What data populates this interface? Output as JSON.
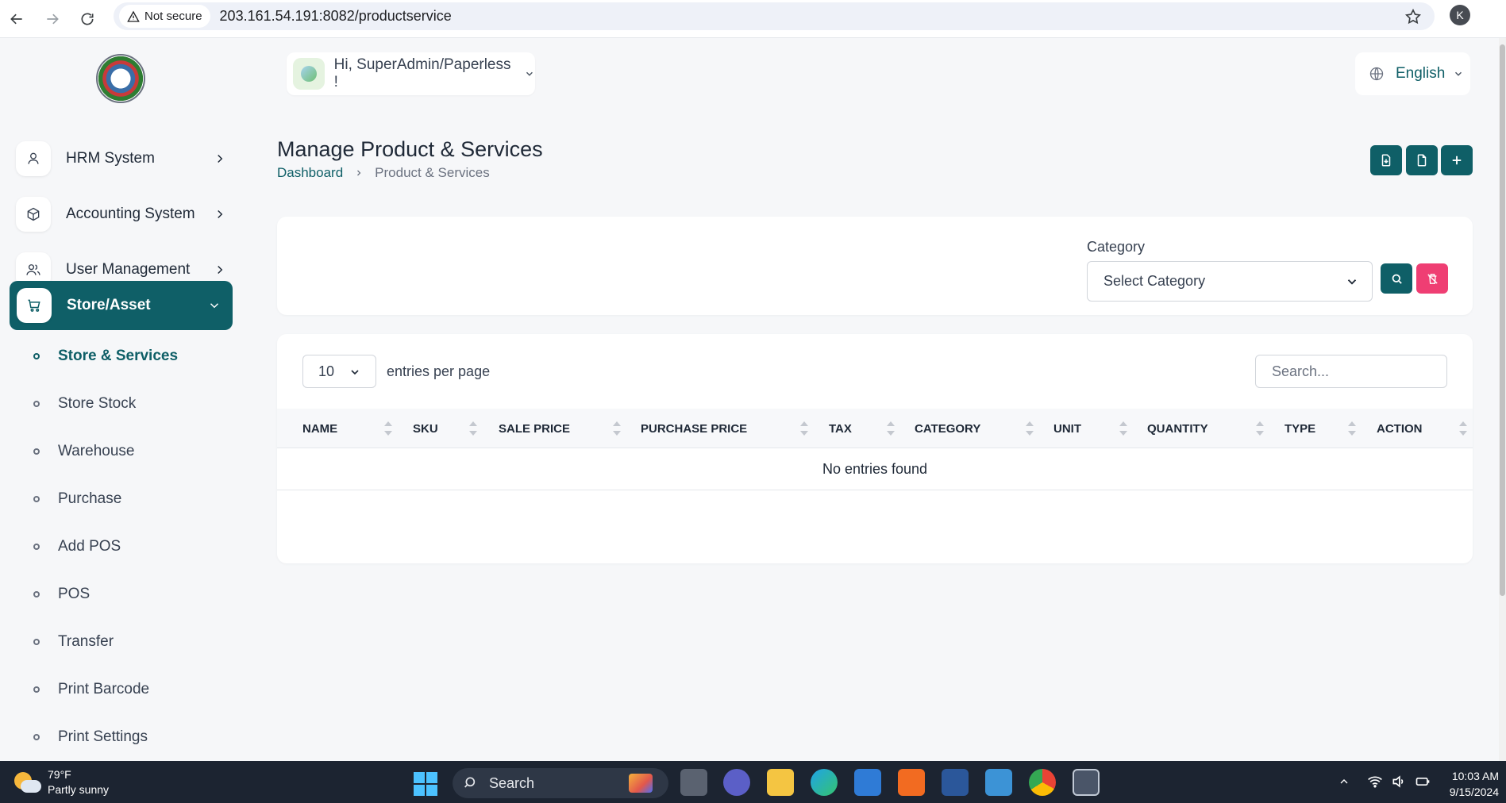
{
  "browser": {
    "security_label": "Not secure",
    "url": "203.161.54.191:8082/productservice",
    "profile_initial": "K"
  },
  "sidebar": {
    "items": [
      {
        "label": "HRM System",
        "icon": "user-icon"
      },
      {
        "label": "Accounting System",
        "icon": "box-icon"
      },
      {
        "label": "User Management",
        "icon": "users-icon"
      },
      {
        "label": "Store/Asset",
        "icon": "cart-icon",
        "active": true
      }
    ],
    "subitems": [
      {
        "label": "Store & Services",
        "active": true
      },
      {
        "label": "Store Stock"
      },
      {
        "label": "Warehouse"
      },
      {
        "label": "Purchase"
      },
      {
        "label": "Add POS"
      },
      {
        "label": "POS"
      },
      {
        "label": "Transfer"
      },
      {
        "label": "Print Barcode"
      },
      {
        "label": "Print Settings"
      }
    ]
  },
  "header": {
    "greeting": "Hi, SuperAdmin/Paperless !",
    "language": "English"
  },
  "page": {
    "title": "Manage Product & Services",
    "breadcrumb": [
      "Dashboard",
      "Product & Services"
    ]
  },
  "filter": {
    "category_label": "Category",
    "category_value": "Select Category"
  },
  "table": {
    "per_page": "10",
    "per_page_label": "entries per page",
    "search_placeholder": "Search...",
    "columns": [
      "NAME",
      "SKU",
      "SALE PRICE",
      "PURCHASE PRICE",
      "TAX",
      "CATEGORY",
      "UNIT",
      "QUANTITY",
      "TYPE",
      "ACTION"
    ],
    "empty_message": "No entries found"
  },
  "taskbar": {
    "temperature": "79°F",
    "weather": "Partly sunny",
    "search_label": "Search",
    "time": "10:03 AM",
    "date": "9/15/2024"
  },
  "colors": {
    "accent": "#0f5f67",
    "danger": "#ef3e73"
  }
}
